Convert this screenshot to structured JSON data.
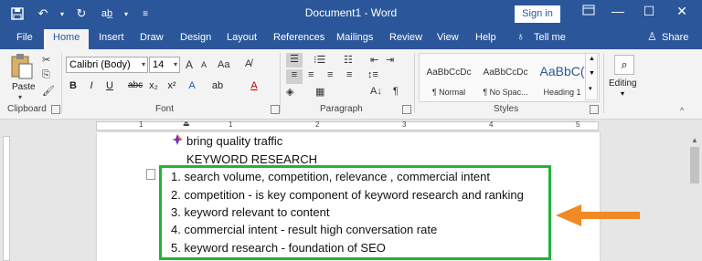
{
  "window": {
    "title": "Document1  -  Word",
    "signin_label": "Sign in"
  },
  "tabs": [
    "File",
    "Home",
    "Insert",
    "Draw",
    "Design",
    "Layout",
    "References",
    "Mailings",
    "Review",
    "View",
    "Help"
  ],
  "tell_me": "Tell me",
  "share": "Share",
  "ribbon": {
    "clipboard_label": "Clipboard",
    "paste_label": "Paste",
    "font_label": "Font",
    "font_name": "Calibri (Body)",
    "font_size": "14",
    "paragraph_label": "Paragraph",
    "styles_label": "Styles",
    "editing_label": "Editing",
    "styles": [
      {
        "sample": "AaBbCcDc",
        "name": "¶ Normal"
      },
      {
        "sample": "AaBbCcDc",
        "name": "¶ No Spac..."
      },
      {
        "sample": "AaBbC(",
        "name": "Heading 1"
      }
    ],
    "font_buttons": {
      "bold": "B",
      "italic": "I",
      "underline": "U",
      "strike": "abc",
      "sub": "x₂",
      "sup": "x²",
      "font_size_grow": "A",
      "font_size_shrink": "A",
      "case": "Aa"
    }
  },
  "ruler": {
    "numbers": [
      "1",
      "1",
      "2",
      "3",
      "4",
      "5"
    ]
  },
  "document": {
    "bullet_line": "bring quality traffic",
    "heading_line": "KEYWORD RESEARCH",
    "list": [
      {
        "num": "1.",
        "text": "search volume, competition, relevance , commercial intent"
      },
      {
        "num": "2.",
        "text": "competition - is key component of keyword research and ranking"
      },
      {
        "num": "3.",
        "text": "keyword relevant to content"
      },
      {
        "num": "4.",
        "text": "commercial intent - result high conversation rate"
      },
      {
        "num": "5.",
        "text": "keyword research - foundation of SEO"
      }
    ]
  },
  "colors": {
    "title_bar": "#2b579a",
    "highlight_border": "#22b43a",
    "arrow": "#f08a24"
  }
}
